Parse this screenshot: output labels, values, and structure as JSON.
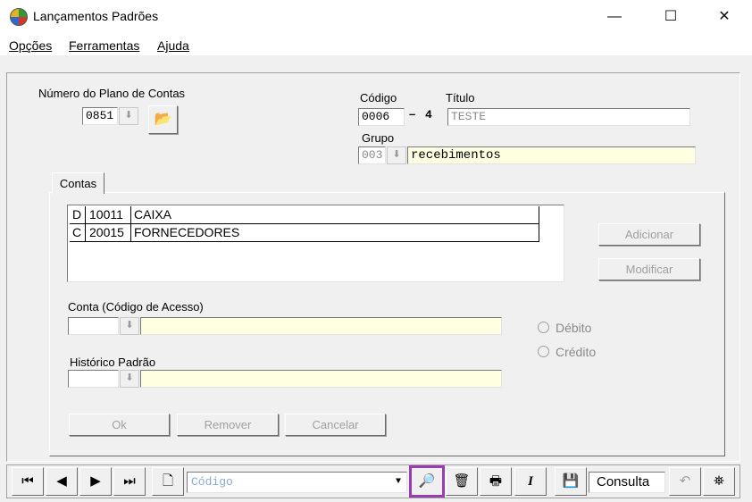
{
  "window": {
    "title": "Lançamentos Padrões",
    "minimize": "—",
    "maximize": "☐",
    "close": "✕"
  },
  "menu": [
    "Opções",
    "Ferramentas",
    "Ajuda"
  ],
  "plano": {
    "label": "Número do Plano de Contas",
    "value": "0851"
  },
  "codigo": {
    "label": "Código",
    "value": "0006",
    "separator": "–",
    "digit": "4"
  },
  "titulo": {
    "label": "Título",
    "value": "TESTE"
  },
  "grupo": {
    "label": "Grupo",
    "code": "003",
    "name": "recebimentos"
  },
  "tab": {
    "label": "Contas"
  },
  "accounts": [
    {
      "type": "D",
      "code": "10011",
      "name": "CAIXA"
    },
    {
      "type": "C",
      "code": "20015",
      "name": "FORNECEDORES"
    }
  ],
  "buttons": {
    "adicionar": "Adicionar",
    "modificar": "Modificar",
    "ok": "Ok",
    "remover": "Remover",
    "cancelar": "Cancelar"
  },
  "conta": {
    "label": "Conta (Código de Acesso)",
    "value": "",
    "name": ""
  },
  "historico": {
    "label": "Histórico Padrão",
    "value": "",
    "name": ""
  },
  "radios": {
    "debito": "Débito",
    "credito": "Crédito"
  },
  "toolbar": {
    "first": "⏮",
    "prev": "◀",
    "next": "▶",
    "last": "⏭",
    "search_placeholder": "Código",
    "italic": "I",
    "status": "Consulta"
  },
  "colors": {
    "highlight": "#9a3db0",
    "yellow_field": "#ffffe1",
    "panel": "#f0f0f0"
  }
}
